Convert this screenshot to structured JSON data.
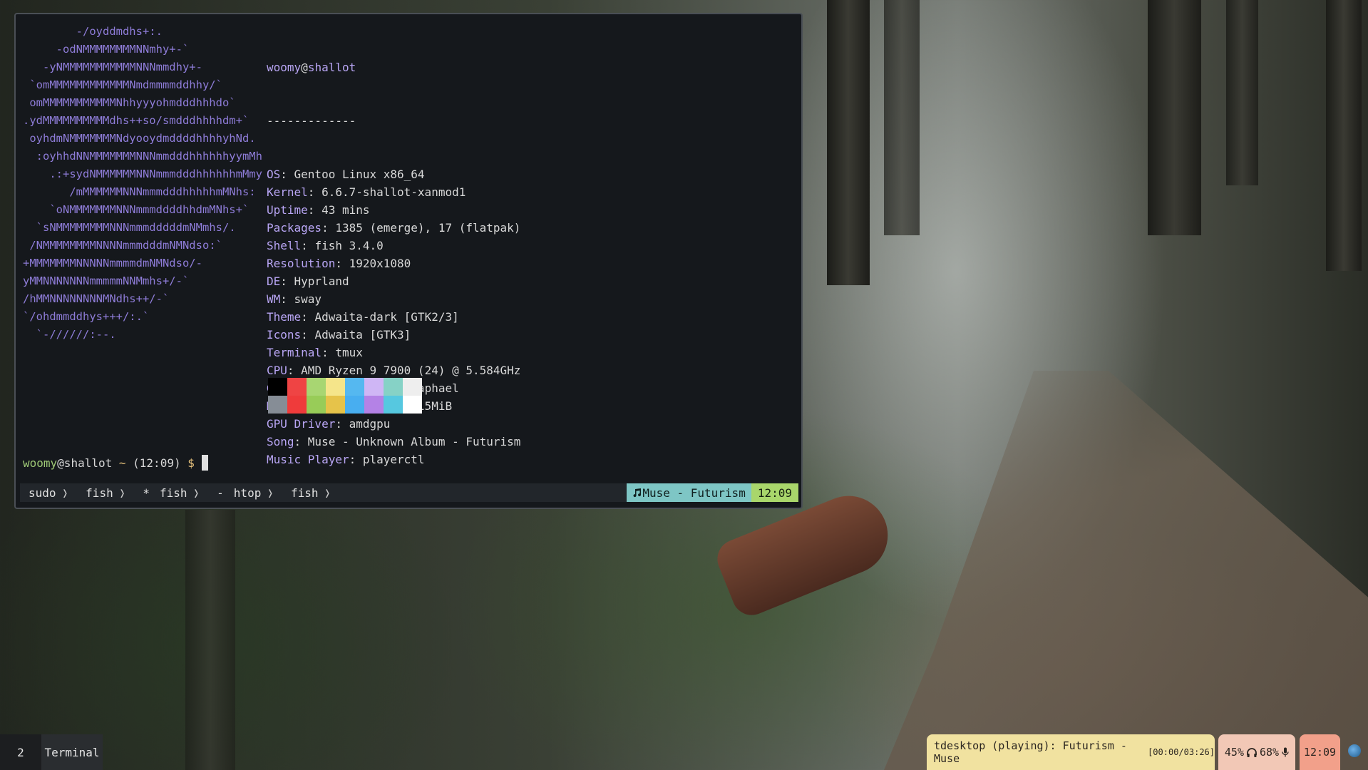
{
  "terminal": {
    "ascii_art": [
      "        -/oyddmdhs+:.",
      "     -odNMMMMMMMMNNmhy+-`",
      "   -yNMMMMMMMMMMMNNNmmdhy+-",
      " `omMMMMMMMMMMMMNmdmmmmddhhy/`",
      " omMMMMMMMMMMMNhhyyyohmdddhhhdo`",
      ".ydMMMMMMMMMMdhs++so/smdddhhhhdm+`",
      " oyhdmNMMMMMMMNdyooydmddddhhhhyhNd.",
      "  :oyhhdNNMMMMMMMNNNmmdddhhhhhhyymMh",
      "    .:+sydNMMMMMMNNNmmmdddhhhhhhmMmy",
      "       /mMMMMMMNNNmmmdddhhhhhmMNhs:",
      "    `oNMMMMMMMNNNmmmddddhhdmMNhs+`",
      "  `sNMMMMMMMMNNNmmmdddddmNMmhs/.",
      " /NMMMMMMMMNNNNmmmdddmNMNdso:`",
      "+MMMMMMMNNNNNmmmmdmNMNdso/-",
      "yMMNNNNNNNmmmmmNNMmhs+/-`",
      "/hMMNNNNNNNNMNdhs++/-`",
      "`/ohdmmddhys+++/:.`",
      "  `-//////:--."
    ],
    "info": {
      "user": "woomy",
      "at": "@",
      "host": "shallot",
      "separator": "-------------",
      "rows": [
        {
          "key": "OS",
          "value": "Gentoo Linux x86_64"
        },
        {
          "key": "Kernel",
          "value": "6.6.7-shallot-xanmod1"
        },
        {
          "key": "Uptime",
          "value": "43 mins"
        },
        {
          "key": "Packages",
          "value": "1385 (emerge), 17 (flatpak)"
        },
        {
          "key": "Shell",
          "value": "fish 3.4.0"
        },
        {
          "key": "Resolution",
          "value": "1920x1080"
        },
        {
          "key": "DE",
          "value": "Hyprland"
        },
        {
          "key": "WM",
          "value": "sway"
        },
        {
          "key": "Theme",
          "value": "Adwaita-dark [GTK2/3]"
        },
        {
          "key": "Icons",
          "value": "Adwaita [GTK3]"
        },
        {
          "key": "Terminal",
          "value": "tmux"
        },
        {
          "key": "CPU",
          "value": "AMD Ryzen 9 7900 (24) @ 5.584GHz"
        },
        {
          "key": "GPU",
          "value": "AMD ATI 10:00.0 Raphael"
        },
        {
          "key": "Memory",
          "value": "37984MiB / 63515MiB"
        },
        {
          "key": "GPU Driver",
          "value": "amdgpu"
        },
        {
          "key": "Song",
          "value": "Muse - Unknown Album - Futurism"
        },
        {
          "key": "Music Player",
          "value": "playerctl"
        }
      ]
    },
    "palette": {
      "top": [
        "#000000",
        "#ef4444",
        "#a8d672",
        "#f5e58a",
        "#55b8f0",
        "#cfb6f5",
        "#86d2c6",
        "#eeeeee"
      ],
      "bottom": [
        "#868d96",
        "#ef3b3b",
        "#98cc58",
        "#e6c34a",
        "#48aef0",
        "#b482e6",
        "#56c8e0",
        "#ffffff"
      ]
    },
    "prompt": {
      "user": "woomy",
      "host": "@shallot",
      "dir": "~",
      "time": "(12:09)",
      "symbol": "$"
    }
  },
  "tmux": {
    "windows": [
      {
        "name": "sudo",
        "flag": ""
      },
      {
        "name": "fish",
        "flag": ""
      },
      {
        "name": "fish",
        "flag": "*"
      },
      {
        "name": "htop",
        "flag": "-"
      },
      {
        "name": "fish",
        "flag": ""
      }
    ],
    "song": "Muse - Futurism",
    "clock": "12:09",
    "song_icon": "music-note-icon"
  },
  "bar": {
    "workspace": "2",
    "window_title": "Terminal",
    "media_text": "tdesktop (playing): Futurism - Muse",
    "media_time": "[00:00/03:26]",
    "volume": "45%",
    "headphone_icon": "headphones-icon",
    "mic_level": "68%",
    "mic_icon": "microphone-icon",
    "clock": "12:09",
    "tray_icon": "telegram-icon"
  },
  "colors": {
    "ascii": "#8e7cd8",
    "key": "#b9a6f5",
    "song_pill": "#7ec6c5",
    "clock_pill": "#a9d66b",
    "media_pill": "#f1e2a0",
    "stats_pill": "#f2c8b6",
    "bar_clock_pill": "#f2a08a"
  }
}
